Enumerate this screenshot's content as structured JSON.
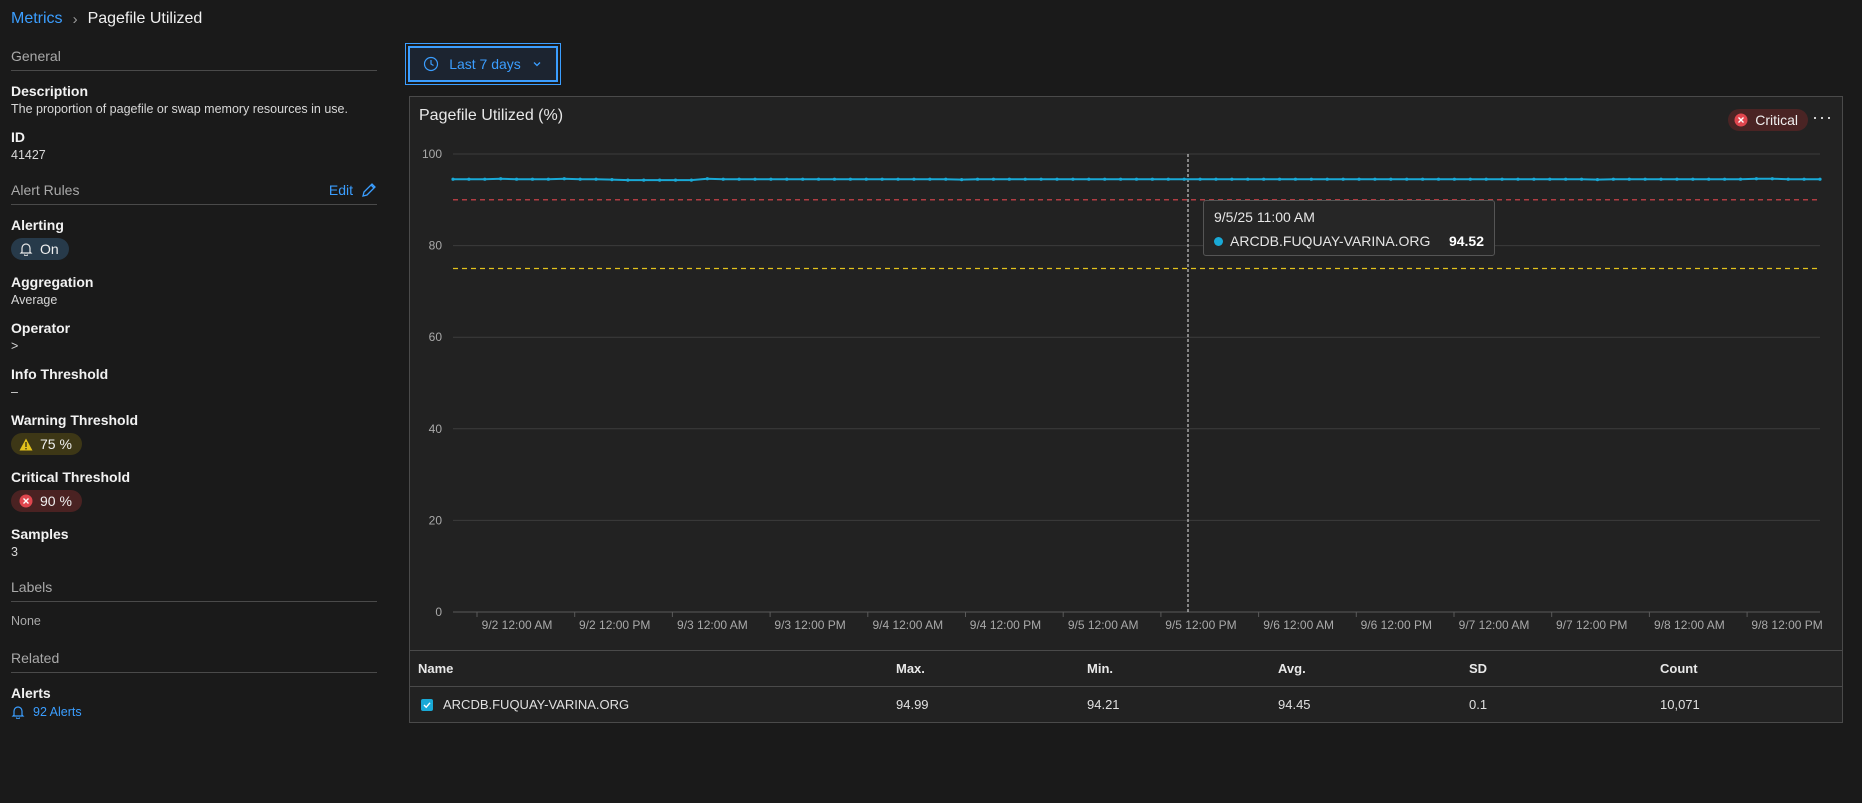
{
  "breadcrumb": {
    "parent": "Metrics",
    "separator": "›",
    "current": "Pagefile Utilized"
  },
  "left": {
    "general_header": "General",
    "description_label": "Description",
    "description_value": "The proportion of pagefile or swap memory resources in use.",
    "id_label": "ID",
    "id_value": "41427",
    "alert_rules_header": "Alert Rules",
    "edit_label": "Edit",
    "alerting_label": "Alerting",
    "alerting_value": "On",
    "aggregation_label": "Aggregation",
    "aggregation_value": "Average",
    "operator_label": "Operator",
    "operator_value": ">",
    "info_threshold_label": "Info Threshold",
    "info_threshold_value": "–",
    "warning_threshold_label": "Warning Threshold",
    "warning_threshold_value": "75 %",
    "critical_threshold_label": "Critical Threshold",
    "critical_threshold_value": "90 %",
    "samples_label": "Samples",
    "samples_value": "3",
    "labels_header": "Labels",
    "labels_value": "None",
    "related_header": "Related",
    "alerts_label": "Alerts",
    "alerts_link": "92 Alerts"
  },
  "toolbar": {
    "time_range": "Last 7 days",
    "icon": "clock-icon"
  },
  "card": {
    "title": "Pagefile Utilized (%)",
    "status_badge": "Critical",
    "more_label": "···"
  },
  "tooltip": {
    "time": "9/5/25 11:00 AM",
    "series": "ARCDB.FUQUAY-VARINA.ORG",
    "value": "94.52"
  },
  "table": {
    "headers": [
      "Name",
      "Max.",
      "Min.",
      "Avg.",
      "SD",
      "Count"
    ],
    "rows": [
      [
        "ARCDB.FUQUAY-VARINA.ORG",
        "94.99",
        "94.21",
        "94.45",
        "0.1",
        "10,071"
      ]
    ]
  },
  "colors": {
    "series": "#19a9d6",
    "critical": "#e0464e",
    "warning": "#e3c21b",
    "accent": "#3b9eff"
  },
  "chart_data": {
    "type": "line",
    "title": "Pagefile Utilized (%)",
    "ylim": [
      0,
      100
    ],
    "yticks": [
      0,
      20,
      40,
      60,
      80,
      100
    ],
    "x_tick_labels": [
      "9/2 12:00 AM",
      "9/2 12:00 PM",
      "9/3 12:00 AM",
      "9/3 12:00 PM",
      "9/4 12:00 AM",
      "9/4 12:00 PM",
      "9/5 12:00 AM",
      "9/5 12:00 PM",
      "9/6 12:00 AM",
      "9/6 12:00 PM",
      "9/7 12:00 AM",
      "9/7 12:00 PM",
      "9/8 12:00 AM",
      "9/8 12:00 PM"
    ],
    "grid": true,
    "thresholds": [
      {
        "name": "Critical",
        "value": 90,
        "color": "#e0464e"
      },
      {
        "name": "Warning",
        "value": 75,
        "color": "#e3c21b"
      }
    ],
    "series": [
      {
        "name": "ARCDB.FUQUAY-VARINA.ORG",
        "color": "#19a9d6",
        "values": [
          94.5,
          94.5,
          94.5,
          94.6,
          94.5,
          94.5,
          94.5,
          94.6,
          94.5,
          94.5,
          94.4,
          94.3,
          94.3,
          94.3,
          94.3,
          94.3,
          94.6,
          94.5,
          94.5,
          94.5,
          94.5,
          94.5,
          94.5,
          94.5,
          94.5,
          94.5,
          94.5,
          94.5,
          94.5,
          94.5,
          94.5,
          94.5,
          94.4,
          94.5,
          94.5,
          94.5,
          94.5,
          94.5,
          94.5,
          94.5,
          94.5,
          94.5,
          94.5,
          94.5,
          94.5,
          94.5,
          94.5,
          94.5,
          94.5,
          94.5,
          94.5,
          94.5,
          94.5,
          94.5,
          94.5,
          94.5,
          94.5,
          94.5,
          94.5,
          94.5,
          94.5,
          94.5,
          94.5,
          94.5,
          94.5,
          94.5,
          94.5,
          94.5,
          94.5,
          94.5,
          94.5,
          94.5,
          94.4,
          94.5,
          94.5,
          94.5,
          94.5,
          94.5,
          94.5,
          94.5,
          94.5,
          94.5,
          94.6,
          94.6,
          94.5,
          94.5,
          94.5
        ]
      }
    ],
    "crosshair_x_label": "9/5/25 11:00 AM"
  }
}
